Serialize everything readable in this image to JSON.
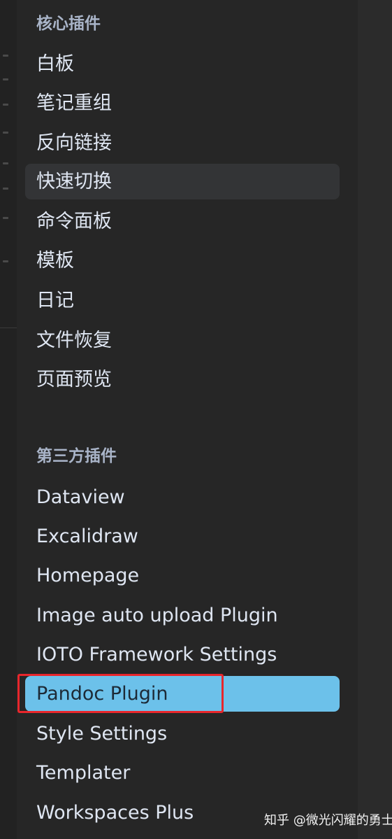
{
  "core_plugins": {
    "title": "核心插件",
    "items": [
      {
        "label": "白板"
      },
      {
        "label": "笔记重组"
      },
      {
        "label": "反向链接"
      },
      {
        "label": "快速切换"
      },
      {
        "label": "命令面板"
      },
      {
        "label": "模板"
      },
      {
        "label": "日记"
      },
      {
        "label": "文件恢复"
      },
      {
        "label": "页面预览"
      }
    ]
  },
  "third_party_plugins": {
    "title": "第三方插件",
    "items": [
      {
        "label": "Dataview"
      },
      {
        "label": "Excalidraw"
      },
      {
        "label": "Homepage"
      },
      {
        "label": "Image auto upload Plugin"
      },
      {
        "label": "IOTO Framework Settings"
      },
      {
        "label": "Pandoc Plugin"
      },
      {
        "label": "Style Settings"
      },
      {
        "label": "Templater"
      },
      {
        "label": "Workspaces Plus"
      }
    ]
  },
  "watermark": {
    "text": "知乎 @微光闪耀的勇士"
  },
  "colors": {
    "selected": "#6cc1ea",
    "highlight_box": "#e8262c",
    "background": "#262626"
  }
}
